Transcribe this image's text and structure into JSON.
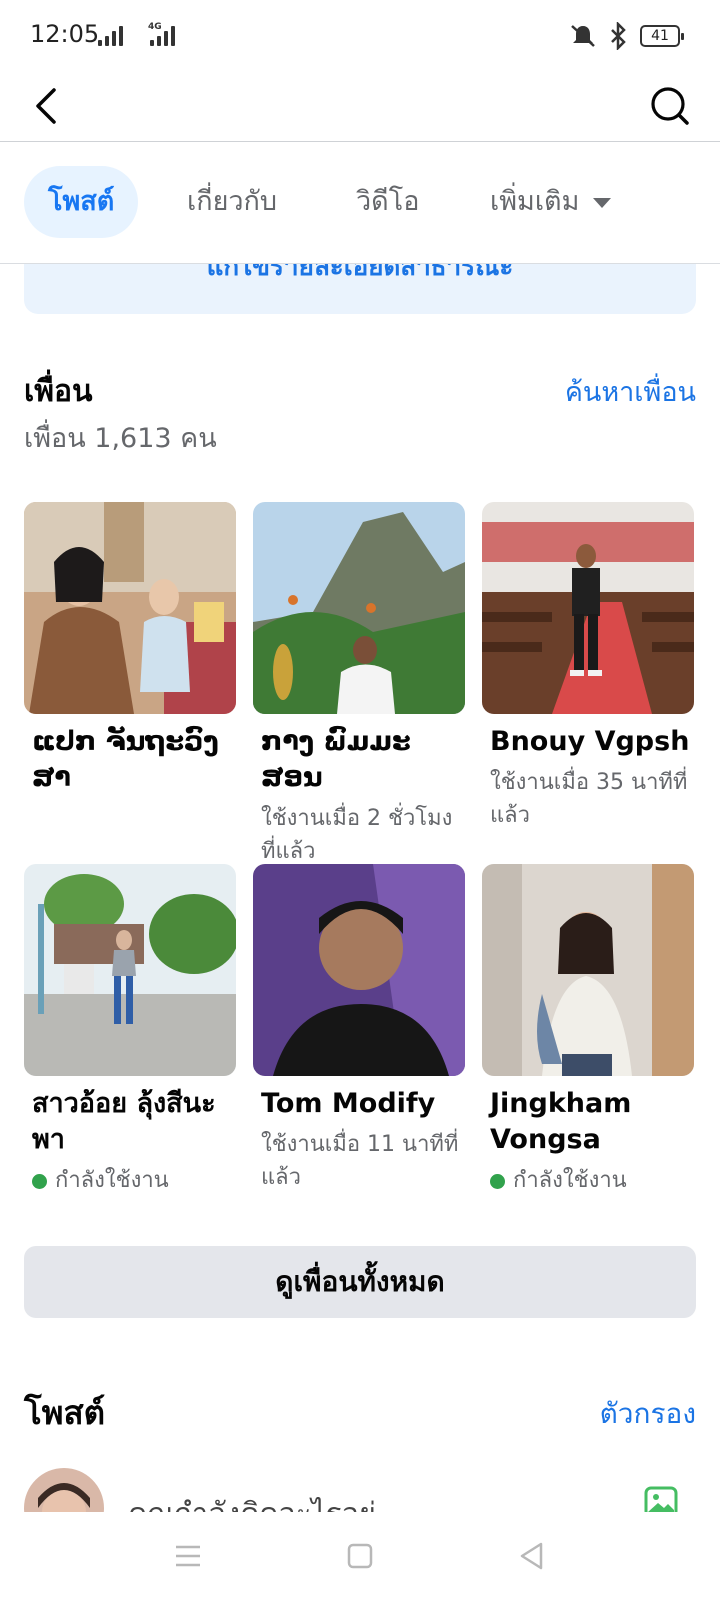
{
  "status_bar": {
    "time": "12:05",
    "network_label": "4G",
    "battery": "41",
    "icons": [
      "signal-icon",
      "mute-vibrate-icon",
      "bluetooth-icon",
      "battery-icon"
    ]
  },
  "header": {
    "back_icon": "arrow-left-icon",
    "search_icon": "search-icon"
  },
  "tabs": [
    {
      "label": "โพสต์",
      "active": true
    },
    {
      "label": "เกี่ยวกับ",
      "active": false
    },
    {
      "label": "วิดีโอ",
      "active": false
    },
    {
      "label": "เพิ่มเติม",
      "active": false
    }
  ],
  "edit_public_details": "แก้ไขรายละเอียดสาธารณะ",
  "friends": {
    "title": "เพื่อน",
    "count_text": "เพื่อน 1,613 คน",
    "find_link": "ค้นหาเพื่อน",
    "list": [
      {
        "name": "ແປກ ຈັນຖະວົງ ສາ",
        "status": "",
        "online": false
      },
      {
        "name": "ກາງ ພົມມະສອນ",
        "status": "ใช้งานเมื่อ 2 ชั่วโมงที่แล้ว",
        "online": false
      },
      {
        "name": "Bnouy Vgpsh",
        "status": "ใช้งานเมื่อ 35 นาทีที่แล้ว",
        "online": false
      },
      {
        "name": "สาวอ้อย ลุ้งสีนะพา",
        "status": "กำลังใช้งาน",
        "online": true
      },
      {
        "name": "Tom Modify",
        "status": "ใช้งานเมื่อ 11 นาทีที่แล้ว",
        "online": false
      },
      {
        "name": "Jingkham Vongsa",
        "status": "กำลังใช้งาน",
        "online": true
      }
    ],
    "see_all": "ดูเพื่อนทั้งหมด"
  },
  "posts": {
    "title": "โพสต์",
    "filter": "ตัวกรอง",
    "composer_prompt": "คุณกำลังคิดอะไรอยู่",
    "photo_icon": "photo-icon"
  },
  "colors": {
    "accent": "#1877f2",
    "link": "#1b74e4",
    "online": "#31a24c",
    "secondary_text": "#65676b"
  }
}
